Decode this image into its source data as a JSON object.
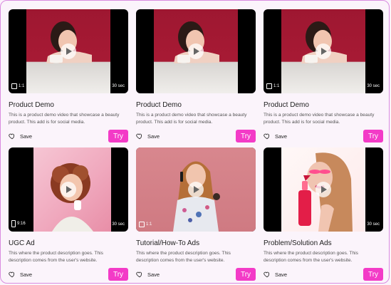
{
  "cards": [
    {
      "title": "Product Demo",
      "desc": "This is a product demo video that showcase a beauty product. This add is for social media.",
      "save_label": "Save",
      "try_label": "Try",
      "ratio": "1:1",
      "duration": "30 sec"
    },
    {
      "title": "Product Demo",
      "desc": "This is a product demo video that showcase a beauty product. This add is for social media.",
      "save_label": "Save",
      "try_label": "Try",
      "ratio": "",
      "duration": ""
    },
    {
      "title": "Product Demo",
      "desc": "This is a product demo video that showcase a beauty product. This add is for social media.",
      "save_label": "Save",
      "try_label": "Try",
      "ratio": "1:1",
      "duration": "30 sec"
    },
    {
      "title": "UGC Ad",
      "desc": "This where the product description goes. This description comes from the user's website.",
      "save_label": "Save",
      "try_label": "Try",
      "ratio": "9:16",
      "duration": "30 sec"
    },
    {
      "title": "Tutorial/How-To Ads",
      "desc": "This where the product description goes. This description comes from the user's website.",
      "save_label": "Save",
      "try_label": "Try",
      "ratio": "1:1",
      "duration": ""
    },
    {
      "title": "Problem/Solution Ads",
      "desc": "This where the product description goes. This description comes from the user's website.",
      "save_label": "Save",
      "try_label": "Try",
      "ratio": "",
      "duration": "30 sec"
    }
  ],
  "icons": {
    "play": "play-icon",
    "heart": "heart-icon",
    "ratio": "aspect-ratio-icon"
  },
  "colors": {
    "accent": "#f33bc7",
    "border": "#d98be0",
    "background": "#fbf4fb"
  }
}
